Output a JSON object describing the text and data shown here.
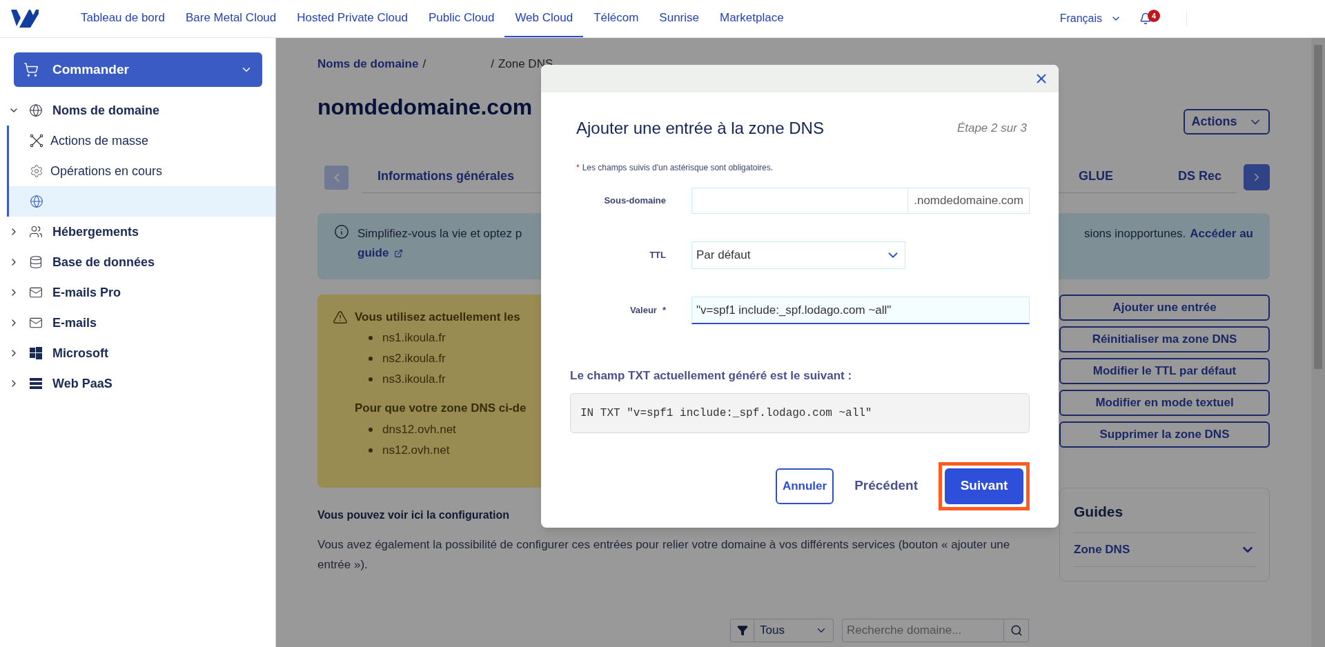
{
  "top_nav": {
    "items": [
      {
        "label": "Tableau de bord",
        "selected": false
      },
      {
        "label": "Bare Metal Cloud",
        "selected": false
      },
      {
        "label": "Hosted Private Cloud",
        "selected": false
      },
      {
        "label": "Public Cloud",
        "selected": false
      },
      {
        "label": "Web Cloud",
        "selected": true
      },
      {
        "label": "Télécom",
        "selected": false
      },
      {
        "label": "Sunrise",
        "selected": false
      },
      {
        "label": "Marketplace",
        "selected": false
      }
    ],
    "language": "Français",
    "notifications_badge": "4"
  },
  "sidebar": {
    "order_button": "Commander",
    "items": [
      {
        "label": "Noms de domaine",
        "expanded": true,
        "children": [
          {
            "label": "Actions de masse",
            "selected": false
          },
          {
            "label": "Opérations en cours",
            "selected": false
          },
          {
            "selected": true
          }
        ]
      },
      {
        "label": "Hébergements",
        "expanded": false
      },
      {
        "label": "Base de données",
        "expanded": false
      },
      {
        "label": "E-mails Pro",
        "expanded": false
      },
      {
        "label": "E-mails",
        "expanded": false
      },
      {
        "label": "Microsoft",
        "expanded": false
      },
      {
        "label": "Web PaaS",
        "expanded": false
      }
    ]
  },
  "breadcrumb": [
    {
      "kind": "link",
      "text": "Noms de domaine"
    },
    {
      "kind": "separator",
      "text": "/"
    },
    {
      "kind": "hidden"
    },
    {
      "kind": "separator",
      "text": "/"
    },
    {
      "kind": "current",
      "text": "Zone DNS"
    }
  ],
  "page_title": "nomdedomaine.com",
  "actions_button": "Actions",
  "tabs": {
    "left": [
      {
        "label": "Informations générales",
        "selected": false
      }
    ],
    "right": [
      {
        "label": "GLUE",
        "selected": false
      },
      {
        "label": "DS Rec",
        "selected": false
      }
    ]
  },
  "info_banner": {
    "text_start": "Simplifiez-vous la vie et optez p",
    "link_start": "guide",
    "text_end": "sions inopportunes.",
    "link_end": "Accéder au"
  },
  "warning": {
    "title": "Vous utilisez actuellement les",
    "current_servers": [
      "ns1.ikoula.fr",
      "ns2.ikoula.fr",
      "ns3.ikoula.fr"
    ],
    "subtitle": "Pour que votre zone DNS ci-de",
    "required_servers": [
      "dns12.ovh.net",
      "ns12.ovh.net"
    ]
  },
  "zone_actions": [
    "Ajouter une entrée",
    "Réinitialiser ma zone DNS",
    "Modifier le TTL par défaut",
    "Modifier en mode textuel",
    "Supprimer la zone DNS"
  ],
  "guides": {
    "title": "Guides",
    "items": [
      {
        "label": "Zone DNS",
        "expanded": false
      }
    ]
  },
  "config_heading": "Vous pouvez voir ici la configuration",
  "config_text": "Vous avez également la possibilité de configurer ces entrées pour relier votre domaine à vos différents services (bouton « ajouter une entrée »).",
  "filter": {
    "type_select": "Tous",
    "search_placeholder": "Recherche domaine..."
  },
  "modal": {
    "title": "Ajouter une entrée à la zone DNS",
    "step": "Étape 2 sur 3",
    "required_note": {
      "mark": "*",
      "text": "Les champs suivis d'un astérisque sont obligatoires."
    },
    "fields": [
      {
        "kind": "suffix",
        "label": "Sous-domaine",
        "suffix": ".nomdedomaine.com",
        "focused": false
      },
      {
        "kind": "select",
        "label": "TTL",
        "value": "Par défaut",
        "focused": false
      },
      {
        "kind": "text",
        "label": "Valeur",
        "required_mark": "*",
        "value": "\"v=spf1 include:_spf.lodago.com ~all\"",
        "focused": true
      }
    ],
    "generated_label": "Le champ TXT actuellement généré est le suivant :",
    "generated_value": "IN TXT \"v=spf1 include:_spf.lodago.com ~all\"",
    "buttons": [
      {
        "kind": "outline",
        "label": "Annuler",
        "highlighted": false
      },
      {
        "kind": "text",
        "label": "Précédent",
        "highlighted": false
      },
      {
        "kind": "primary",
        "label": "Suivant",
        "highlighted": true
      }
    ]
  }
}
